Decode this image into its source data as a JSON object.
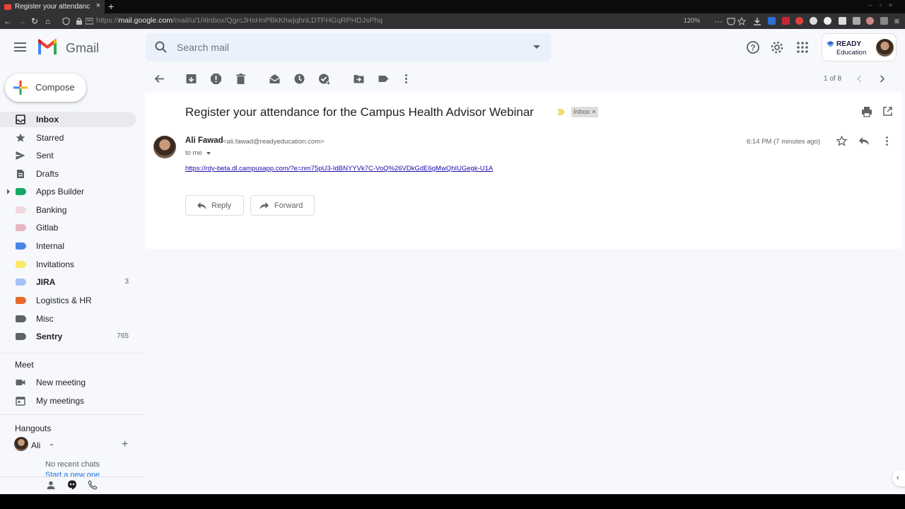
{
  "browser": {
    "tab_title": "Register your attendanc",
    "tab_close": "×",
    "new_tab": "+",
    "url_prefix": "https://",
    "url_host": "mail.google.com",
    "url_path": "/mail/u/1/#inbox/QgrcJHsHnPBkKhwjqhnLDTFHGqRPHDJsPhq",
    "zoom": "120%"
  },
  "header": {
    "brand": "Gmail",
    "search_placeholder": "Search mail",
    "org_line1": "READY",
    "org_line2": "Education"
  },
  "sidebar": {
    "compose_label": "Compose",
    "items": [
      {
        "label": "Inbox",
        "count": "",
        "bold": true
      },
      {
        "label": "Starred",
        "count": ""
      },
      {
        "label": "Sent",
        "count": ""
      },
      {
        "label": "Drafts",
        "count": ""
      },
      {
        "label": "Apps Builder",
        "count": "",
        "color": "#16a765"
      },
      {
        "label": "Banking",
        "count": "",
        "color": "#f2d9df"
      },
      {
        "label": "Gitlab",
        "count": "",
        "color": "#e7b8c4"
      },
      {
        "label": "Internal",
        "count": "",
        "color": "#4a86e8"
      },
      {
        "label": "Invitations",
        "count": "",
        "color": "#fce968"
      },
      {
        "label": "JIRA",
        "count": "3",
        "color": "#a4c2f4",
        "bold": true
      },
      {
        "label": "Logistics & HR",
        "count": "",
        "color": "#e66b2c"
      },
      {
        "label": "Misc",
        "count": "",
        "color": "#5f6368"
      },
      {
        "label": "Sentry",
        "count": "765",
        "color": "#5f6368",
        "bold": true
      }
    ],
    "meet_title": "Meet",
    "meet_items": [
      "New meeting",
      "My meetings"
    ],
    "hangouts_title": "Hangouts",
    "hangouts_user": "Ali",
    "hangouts_add": "+",
    "no_chats": "No recent chats",
    "start_new": "Start a new one"
  },
  "toolbar": {
    "pager": "1 of 8"
  },
  "email": {
    "subject": "Register your attendance for the Campus Health Advisor Webinar",
    "label_chip": "Inbox",
    "label_chip_close": "×",
    "sender_name": "Ali Fawad",
    "sender_email": "<ali.fawad@readyeducation.com>",
    "to": "to me",
    "time": "6:14 PM (7 minutes ago)",
    "link": "https://rdy-beta.dl.campusapp.com/?e=nm75pU3-IdBNYYVk7C-VoQ%26VDkGdE6gMwQhIUGegk-U1A",
    "reply_label": "Reply",
    "forward_label": "Forward"
  },
  "colors": {
    "accent": "#1a73e8",
    "link": "#1a0dab",
    "background": "#f6f8fc"
  }
}
